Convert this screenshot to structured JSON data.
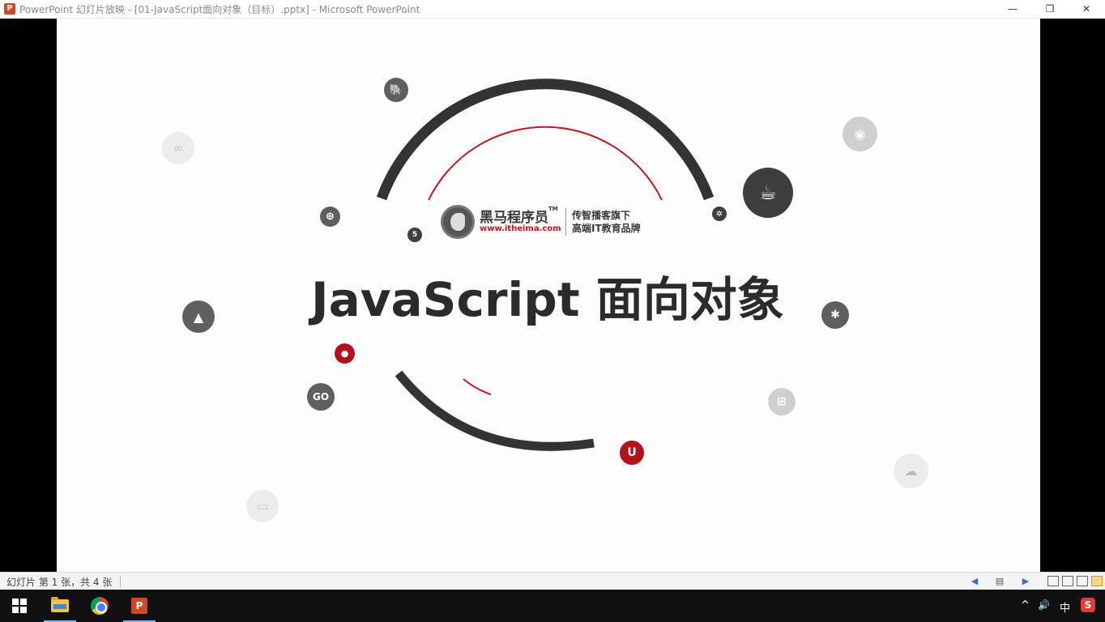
{
  "window": {
    "title": "PowerPoint 幻灯片放映 - [01-JavaScript面向对象（目标）.pptx] - Microsoft PowerPoint",
    "app_icon": "P",
    "controls": {
      "minimize": "—",
      "maximize": "❐",
      "close": "✕"
    }
  },
  "slide": {
    "logo": {
      "brand": "黑马程序员",
      "trademark": "TM",
      "url": "www.itheima.com",
      "slogan_line1": "传智播客旗下",
      "slogan_line2": "高端IT教育品牌"
    },
    "headline": "JavaScript 面向对象",
    "icons": [
      {
        "name": "elephant-icon",
        "glyph": "🐘"
      },
      {
        "name": "globe-icon",
        "glyph": "⊕"
      },
      {
        "name": "html5-icon",
        "glyph": "5"
      },
      {
        "name": "java-icon",
        "glyph": "☕"
      },
      {
        "name": "python-icon",
        "glyph": "✲"
      },
      {
        "name": "linux-icon",
        "glyph": "▲"
      },
      {
        "name": "user-icon",
        "glyph": "●"
      },
      {
        "name": "go-icon",
        "glyph": "GO"
      },
      {
        "name": "bug-icon",
        "glyph": "✱"
      },
      {
        "name": "cart-icon",
        "glyph": "⊞"
      },
      {
        "name": "ui-icon",
        "glyph": "U"
      },
      {
        "name": "eye-icon",
        "glyph": "◉"
      },
      {
        "name": "cloud-icon",
        "glyph": "☁"
      },
      {
        "name": "link-icon",
        "glyph": "∞"
      },
      {
        "name": "window-icon",
        "glyph": "▭"
      }
    ]
  },
  "statusbar": {
    "slide_info": "幻灯片 第 1 张，共 4 张",
    "prev": "◀",
    "menu": "▤",
    "next": "▶"
  },
  "taskbar": {
    "tray_up": "^",
    "volume": "🔊",
    "ime": "中",
    "sogou": "S"
  },
  "colors": {
    "arc_dark": "#333333",
    "arc_red": "#c8161d",
    "slide_bg": "#fdfdfd"
  }
}
